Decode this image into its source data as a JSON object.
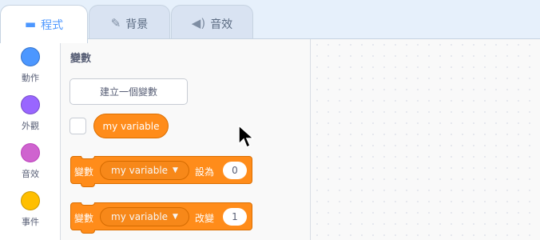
{
  "tabs": [
    {
      "label": "程式",
      "icon": "code-icon"
    },
    {
      "label": "背景",
      "icon": "brush-icon"
    },
    {
      "label": "音效",
      "icon": "speaker-icon"
    }
  ],
  "categories": [
    {
      "label": "動作",
      "color": "#4c97ff"
    },
    {
      "label": "外觀",
      "color": "#9966ff"
    },
    {
      "label": "音效",
      "color": "#cf63cf"
    },
    {
      "label": "事件",
      "color": "#ffbf00"
    }
  ],
  "palette": {
    "title": "變數",
    "make_variable": "建立一個變數",
    "reporter": "my variable"
  },
  "blocks": [
    {
      "label": "變數",
      "variable": "my variable",
      "op": "設為",
      "value": "0"
    },
    {
      "label": "變數",
      "variable": "my variable",
      "op": "改變",
      "value": "1"
    }
  ],
  "colors": {
    "accent": "#4c97ff",
    "variables": "#ff8c1a"
  }
}
